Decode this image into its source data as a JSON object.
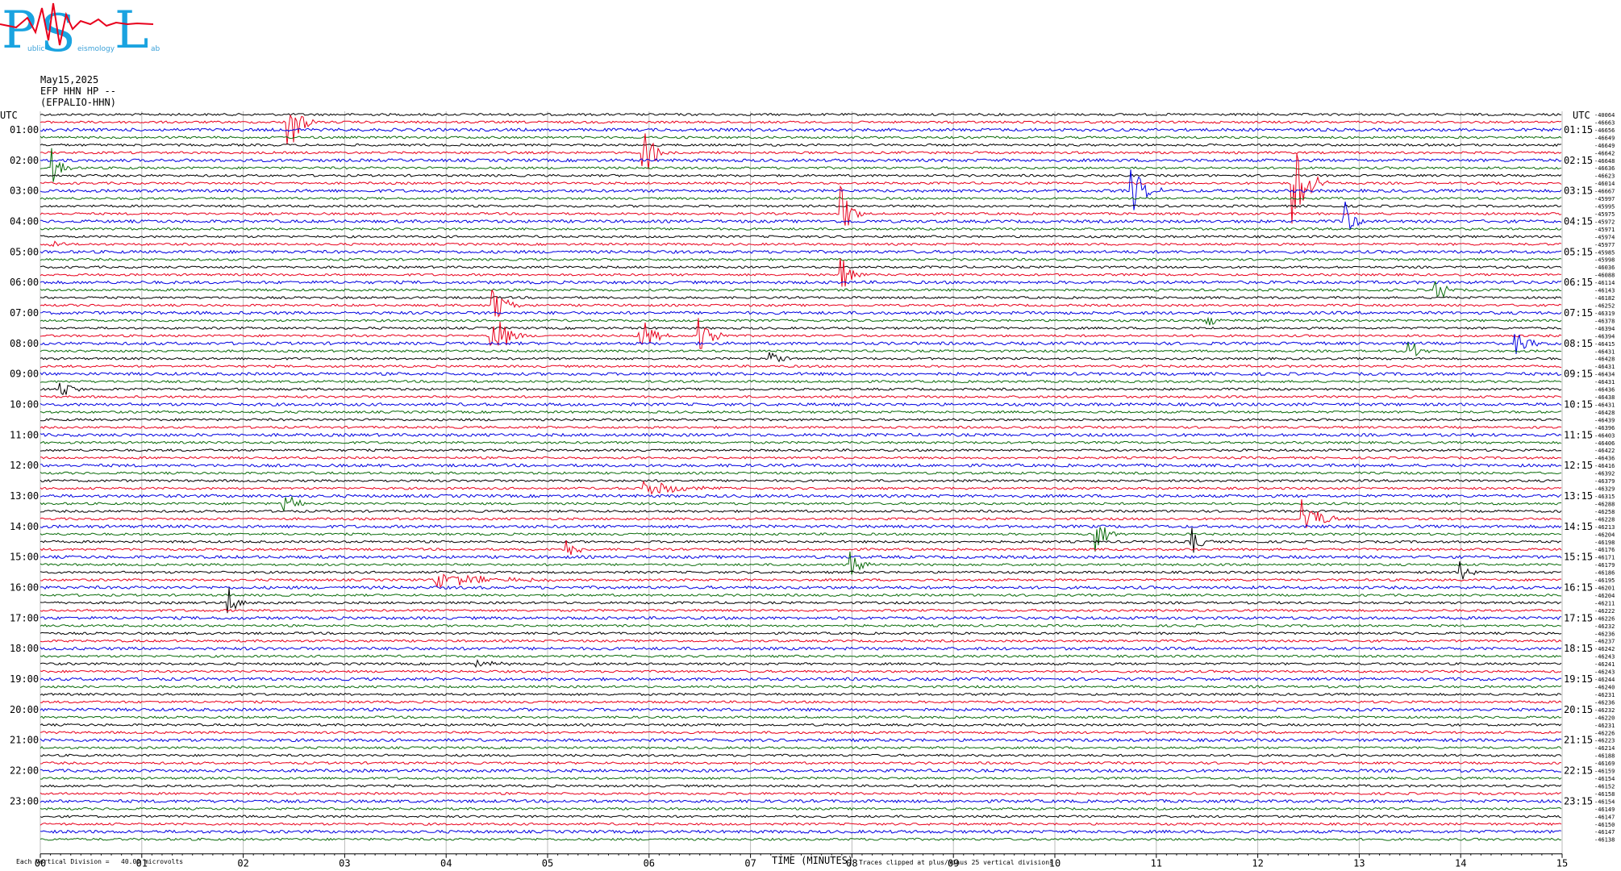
{
  "logo": {
    "letters": [
      "P",
      "S",
      "L"
    ],
    "small_words": [
      "ublic",
      "eismology",
      "ab"
    ],
    "colors": {
      "blue": "#1aa3e0",
      "red": "#e8001c"
    }
  },
  "header": {
    "date": "May15,2025",
    "station": "EFP HHN HP --",
    "name": "(EFPALIO-HHN)"
  },
  "footer": {
    "vertical_division": "Each Vertical Division =   40.00 microvolts",
    "clip_note": "Traces clipped at plus/minus 25 vertical divisions"
  },
  "chart_data": {
    "type": "line",
    "xlabel": "TIME (MINUTES)",
    "x_ticks": [
      "00",
      "01",
      "02",
      "03",
      "04",
      "05",
      "06",
      "07",
      "08",
      "09",
      "10",
      "11",
      "12",
      "13",
      "14",
      "15"
    ],
    "xlim": [
      0,
      15
    ],
    "left_axis_label": "UTC",
    "right_axis_label": "UTC",
    "left_time_labels": [
      "01:00",
      "02:00",
      "03:00",
      "04:00",
      "05:00",
      "06:00",
      "07:00",
      "08:00",
      "09:00",
      "10:00",
      "11:00",
      "12:00",
      "13:00",
      "14:00",
      "15:00",
      "16:00",
      "17:00",
      "18:00",
      "19:00",
      "20:00",
      "21:00",
      "22:00",
      "23:00"
    ],
    "right_time_labels": [
      "01:15",
      "02:15",
      "03:15",
      "04:15",
      "05:15",
      "06:15",
      "07:15",
      "08:15",
      "09:15",
      "10:15",
      "11:15",
      "12:15",
      "13:15",
      "14:15",
      "15:15",
      "16:15",
      "17:15",
      "18:15",
      "19:15",
      "20:15",
      "21:15",
      "22:15",
      "23:15"
    ],
    "trace_colors": [
      "#000000",
      "#e8001c",
      "#0000e0",
      "#0a6b0a"
    ],
    "rows": 96,
    "right_offsets": [
      "40064",
      "46663",
      "46656",
      "46649",
      "46649",
      "46642",
      "46648",
      "46636",
      "46623",
      "46014",
      "46667",
      "45997",
      "45995",
      "45975",
      "45972",
      "45971",
      "45974",
      "45977",
      "45985",
      "45998",
      "46036",
      "46088",
      "46114",
      "46143",
      "46182",
      "46252",
      "46319",
      "46378",
      "46394",
      "46394",
      "46415",
      "46431",
      "46428",
      "46431",
      "46434",
      "46431",
      "46436",
      "46438",
      "46431",
      "46428",
      "46439",
      "46396",
      "46403",
      "46406",
      "46422",
      "46436",
      "46416",
      "46392",
      "46379",
      "46329",
      "46315",
      "46288",
      "46258",
      "46228",
      "46213",
      "46204",
      "46198",
      "46176",
      "46171",
      "46179",
      "46186",
      "46195",
      "46201",
      "46204",
      "46211",
      "46222",
      "46226",
      "46232",
      "46236",
      "46237",
      "46242",
      "46243",
      "46241",
      "46243",
      "46244",
      "46240",
      "46231",
      "46236",
      "46232",
      "46220",
      "46231",
      "46226",
      "46223",
      "46214",
      "46188",
      "46169",
      "46159",
      "46154",
      "46152",
      "46158",
      "46154",
      "46149",
      "46147",
      "46150",
      "46147",
      "46138"
    ],
    "events": [
      {
        "row": 1,
        "minute": 2.45,
        "amp": 45,
        "len": 0.25
      },
      {
        "row": 5,
        "minute": 5.95,
        "amp": 40,
        "len": 0.25
      },
      {
        "row": 7,
        "minute": 0.12,
        "amp": 25,
        "len": 0.2
      },
      {
        "row": 9,
        "minute": 12.35,
        "amp": 60,
        "len": 0.35
      },
      {
        "row": 10,
        "minute": 10.75,
        "amp": 35,
        "len": 0.3
      },
      {
        "row": 13,
        "minute": 7.9,
        "amp": 35,
        "len": 0.25
      },
      {
        "row": 14,
        "minute": 12.85,
        "amp": 30,
        "len": 0.2
      },
      {
        "row": 17,
        "minute": 0.1,
        "amp": 14,
        "len": 0.2
      },
      {
        "row": 21,
        "minute": 7.9,
        "amp": 28,
        "len": 0.25
      },
      {
        "row": 23,
        "minute": 13.75,
        "amp": 25,
        "len": 0.2
      },
      {
        "row": 25,
        "minute": 4.45,
        "amp": 30,
        "len": 0.3
      },
      {
        "row": 27,
        "minute": 11.5,
        "amp": 12,
        "len": 0.2
      },
      {
        "row": 29,
        "minute": 4.45,
        "amp": 38,
        "len": 0.35
      },
      {
        "row": 29,
        "minute": 5.9,
        "amp": 30,
        "len": 0.3
      },
      {
        "row": 29,
        "minute": 6.5,
        "amp": 28,
        "len": 0.3
      },
      {
        "row": 30,
        "minute": 14.55,
        "amp": 18,
        "len": 0.25
      },
      {
        "row": 31,
        "minute": 13.5,
        "amp": 16,
        "len": 0.2
      },
      {
        "row": 32,
        "minute": 7.2,
        "amp": 10,
        "len": 0.3
      },
      {
        "row": 36,
        "minute": 0.2,
        "amp": 10,
        "len": 0.3
      },
      {
        "row": 49,
        "minute": 5.95,
        "amp": 12,
        "len": 0.8
      },
      {
        "row": 51,
        "minute": 2.4,
        "amp": 18,
        "len": 0.25
      },
      {
        "row": 53,
        "minute": 12.45,
        "amp": 28,
        "len": 0.4
      },
      {
        "row": 55,
        "minute": 10.4,
        "amp": 24,
        "len": 0.3
      },
      {
        "row": 56,
        "minute": 11.35,
        "amp": 18,
        "len": 0.25
      },
      {
        "row": 57,
        "minute": 5.2,
        "amp": 16,
        "len": 0.25
      },
      {
        "row": 59,
        "minute": 7.98,
        "amp": 18,
        "len": 0.25
      },
      {
        "row": 60,
        "minute": 14.0,
        "amp": 18,
        "len": 0.2
      },
      {
        "row": 61,
        "minute": 3.9,
        "amp": 10,
        "len": 1.4
      },
      {
        "row": 64,
        "minute": 1.85,
        "amp": 22,
        "len": 0.2
      },
      {
        "row": 72,
        "minute": 4.3,
        "amp": 6,
        "len": 0.5
      }
    ]
  }
}
